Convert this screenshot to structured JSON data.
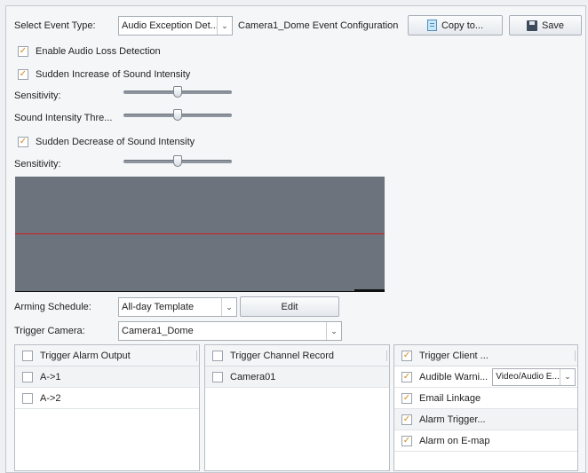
{
  "header": {
    "event_type_label": "Select Event Type:",
    "event_type_value": "Audio Exception Det...",
    "config_title": "Camera1_Dome Event Configuration",
    "copy_label": "Copy to...",
    "save_label": "Save"
  },
  "detection": {
    "audio_loss": {
      "label": "Enable Audio Loss Detection",
      "checked": true
    },
    "sudden_increase": {
      "label": "Sudden Increase of Sound Intensity",
      "checked": true
    },
    "sensitivity_label": "Sensitivity:",
    "sensitivity_value": 0.5,
    "threshold_label": "Sound Intensity Thre...",
    "threshold_value": 0.5,
    "sudden_decrease": {
      "label": "Sudden Decrease of Sound Intensity",
      "checked": true
    },
    "sensitivity2_label": "Sensitivity:",
    "sensitivity2_value": 0.5
  },
  "colors": {
    "waveform_bg": "#6d737d",
    "threshold_line": "#d01e1e",
    "check": "#d88a17"
  },
  "schedule": {
    "label": "Arming Schedule:",
    "value": "All-day Template",
    "edit_label": "Edit"
  },
  "trigger_camera": {
    "label": "Trigger Camera:",
    "value": "Camera1_Dome"
  },
  "alarm_output": {
    "header": "Trigger Alarm Output",
    "items": [
      {
        "label": "A->1",
        "checked": false
      },
      {
        "label": "A->2",
        "checked": false
      }
    ]
  },
  "channel_record": {
    "header": "Trigger Channel Record",
    "items": [
      {
        "label": "Camera01",
        "checked": false
      }
    ]
  },
  "linkage": {
    "header": "Trigger Client ...",
    "items": [
      {
        "label": "Audible Warni...",
        "checked": true
      },
      {
        "label": "Email Linkage",
        "checked": true
      },
      {
        "label": "Alarm Trigger...",
        "checked": true
      },
      {
        "label": "Alarm on E-map",
        "checked": true
      }
    ],
    "audible_select": "Video/Audio E..."
  }
}
